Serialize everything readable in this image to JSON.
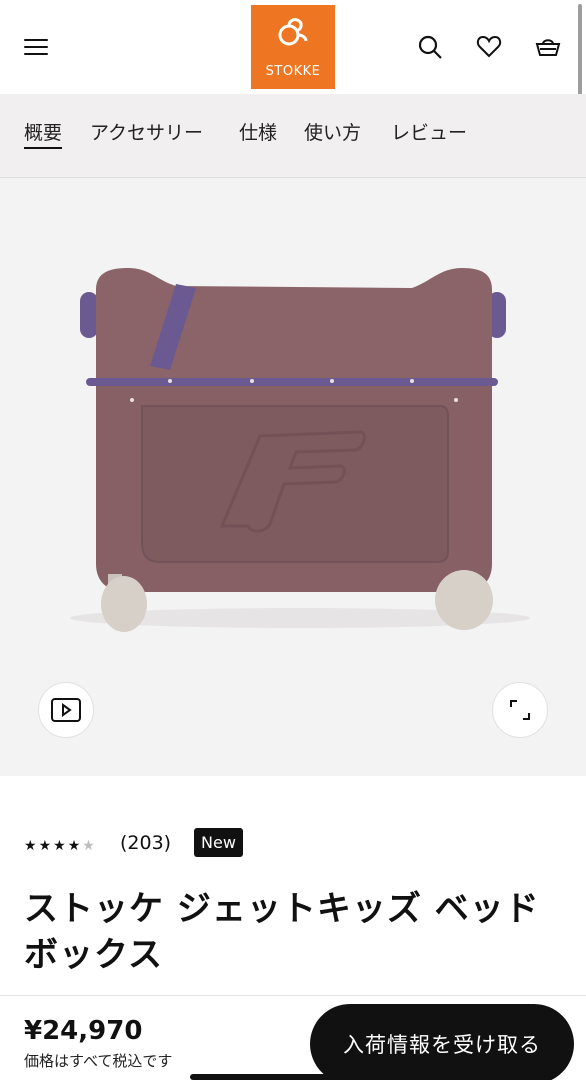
{
  "header": {
    "menu_icon": "hamburger-menu-icon",
    "brand": "STOKKE",
    "brand_color": "#ee7521",
    "icons": [
      "search-icon",
      "heart-icon",
      "cart-icon"
    ]
  },
  "tabs": [
    {
      "label": "概要",
      "active": true
    },
    {
      "label": "アクセサリー",
      "active": false
    },
    {
      "label": "仕様",
      "active": false
    },
    {
      "label": "使い方",
      "active": false
    },
    {
      "label": "レビュー",
      "active": false
    }
  ],
  "gallery": {
    "video_icon": "play-video-icon",
    "fullscreen_icon": "expand-icon",
    "product_color": "#8a6468",
    "strap_color": "#6b5a92"
  },
  "product": {
    "rating": 4,
    "rating_max": 5,
    "review_count": "(203)",
    "badge": "New",
    "title": "ストッケ ジェットキッズ ベッドボックス"
  },
  "purchase": {
    "price": "¥24,970",
    "tax_note": "価格はすべて税込です",
    "cta_label": "入荷情報を受け取る"
  }
}
